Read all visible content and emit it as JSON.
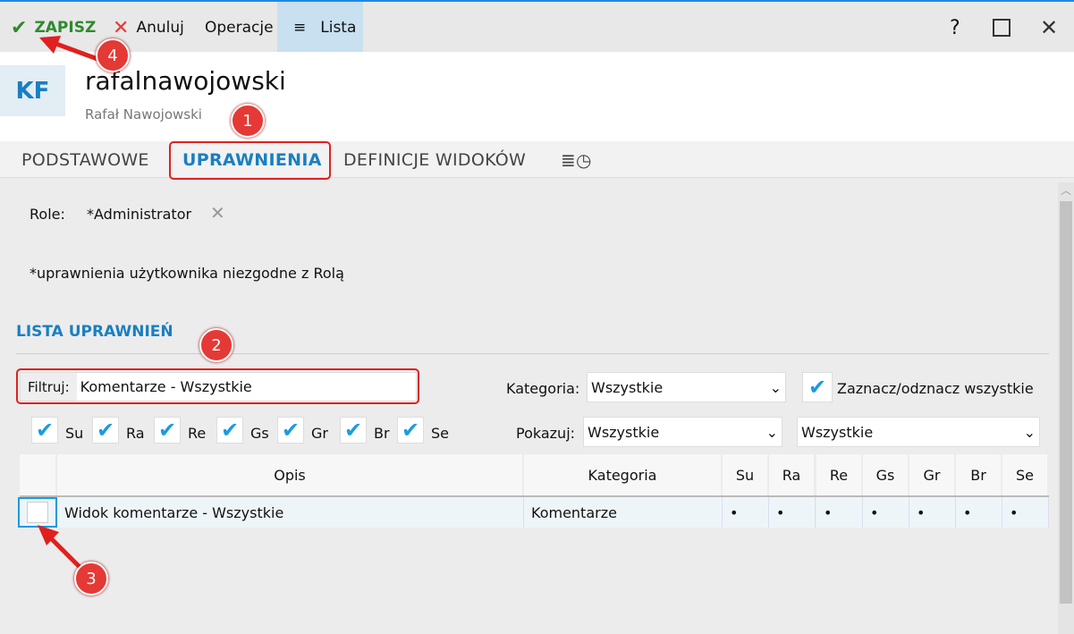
{
  "toolbar": {
    "save": "ZAPISZ",
    "cancel": "Anuluj",
    "operations": "Operacje",
    "list": "Lista",
    "help": "?"
  },
  "header": {
    "avatar": "KF",
    "login": "rafalnawojowski",
    "full_name": "Rafał Nawojowski"
  },
  "tabs": [
    "PODSTAWOWE",
    "UPRAWNIENIA",
    "DEFINICJE WIDOKÓW"
  ],
  "roles": {
    "label": "Role:",
    "value": "*Administrator"
  },
  "note": "*uprawnienia użytkownika niezgodne z Rolą",
  "section_title": "LISTA UPRAWNIEŃ",
  "filter": {
    "label": "Filtruj:",
    "value": "Komentarze - Wszystkie"
  },
  "category": {
    "label": "Kategoria:",
    "value": "Wszystkie"
  },
  "select_all": "Zaznacz/odznacz wszystkie",
  "show": {
    "label": "Pokazuj:",
    "value1": "Wszystkie",
    "value2": "Wszystkie"
  },
  "flags": [
    "Su",
    "Ra",
    "Re",
    "Gs",
    "Gr",
    "Br",
    "Se"
  ],
  "table": {
    "headers": [
      "Opis",
      "Kategoria",
      "Su",
      "Ra",
      "Re",
      "Gs",
      "Gr",
      "Br",
      "Se"
    ],
    "rows": [
      {
        "opis": "Widok komentarze - Wszystkie",
        "kategoria": "Komentarze",
        "flags": [
          "•",
          "•",
          "•",
          "•",
          "•",
          "•",
          "•"
        ]
      }
    ]
  },
  "annotations": [
    "1",
    "2",
    "3",
    "4"
  ],
  "colors": {
    "accent": "#1a7fc1",
    "save": "#2e8b2e",
    "annotation": "#e53935"
  }
}
